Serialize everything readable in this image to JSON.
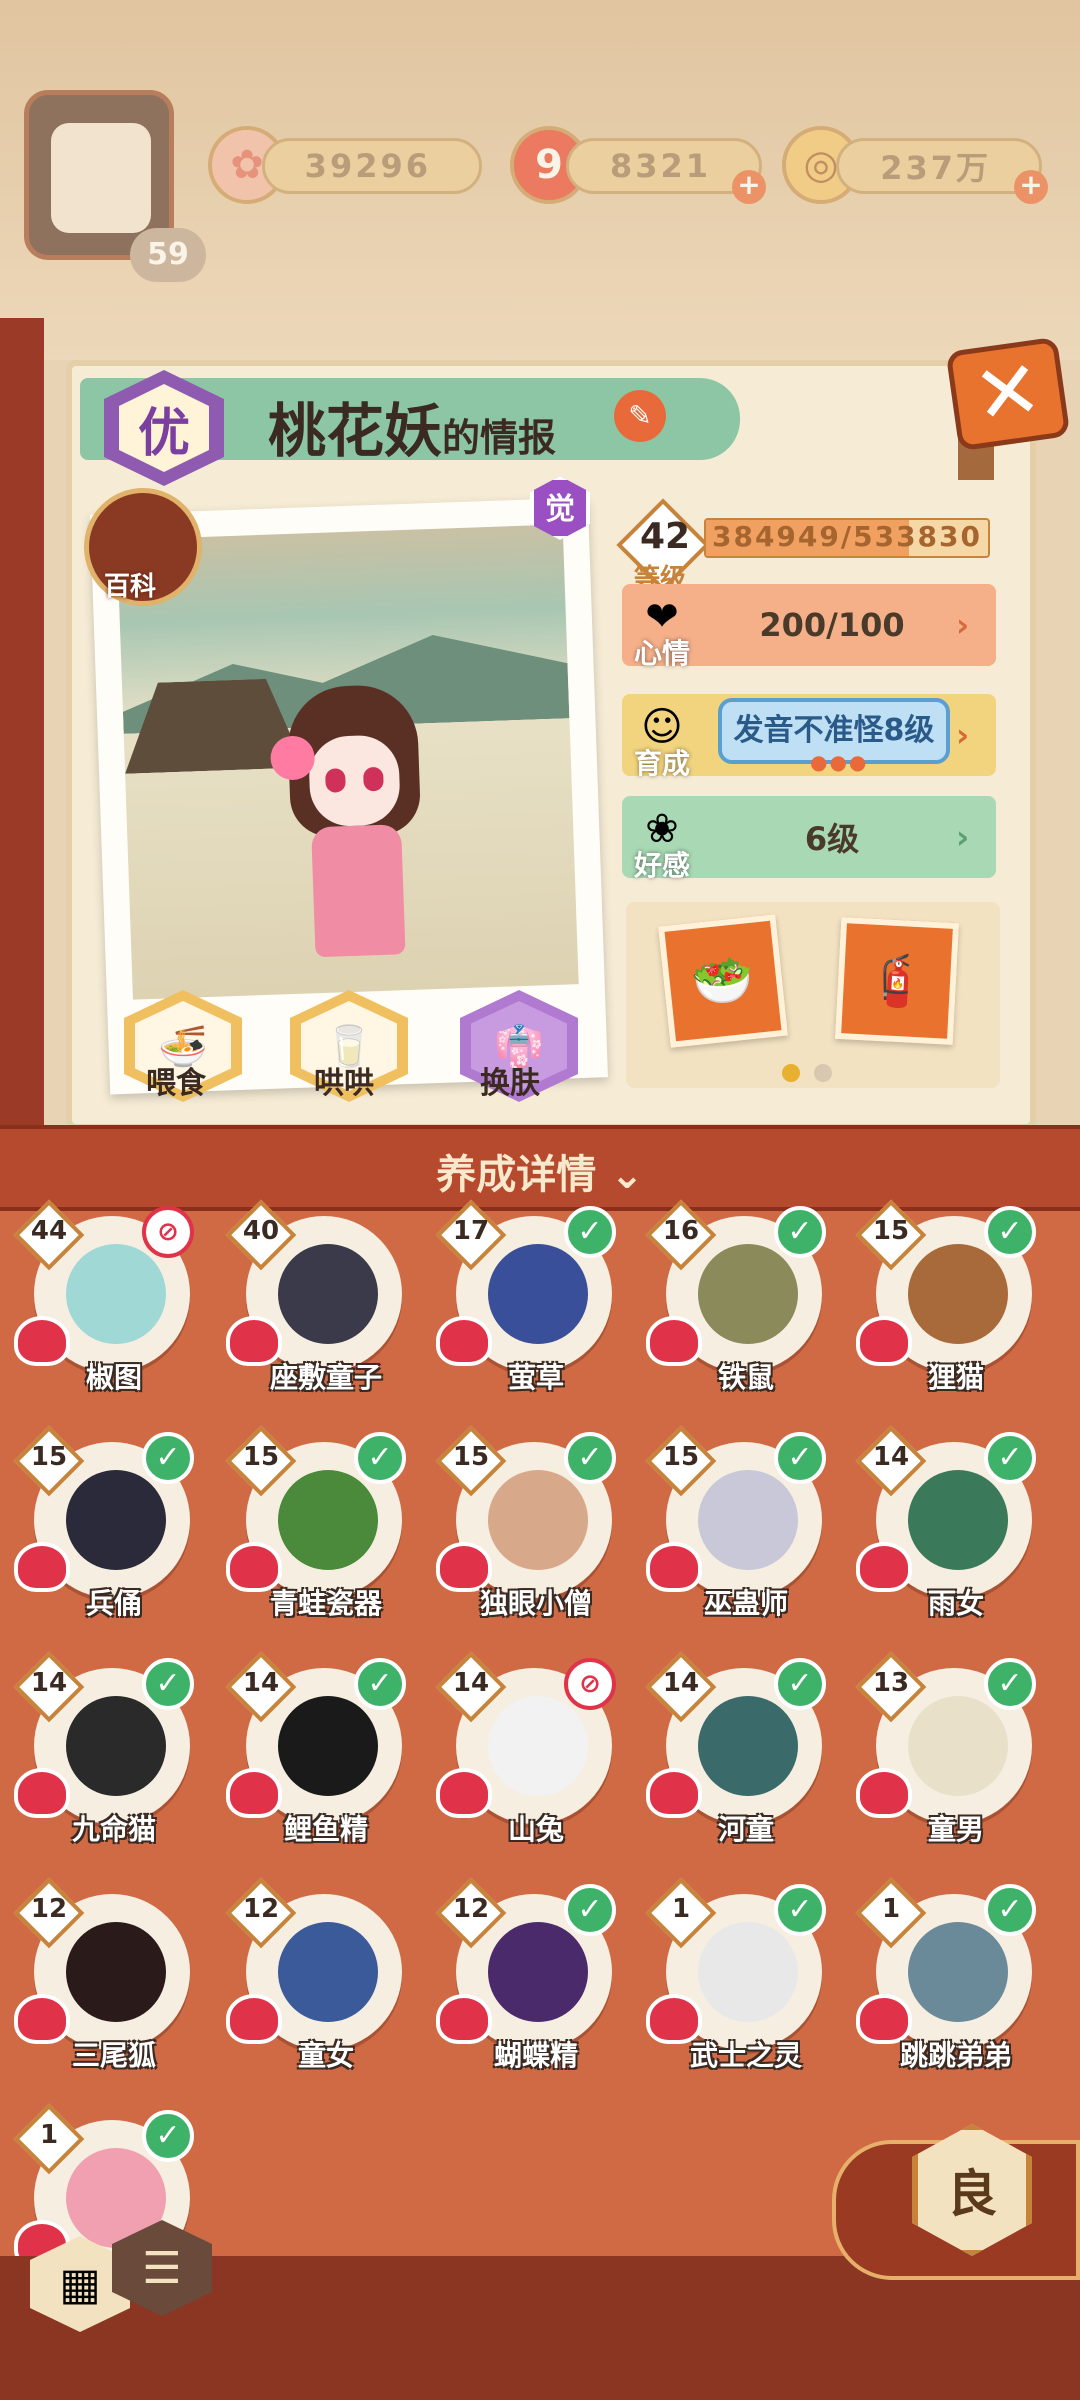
{
  "resources": {
    "sakura_value": "39296",
    "magatama_value": "8321",
    "coins_value": "237万"
  },
  "player": {
    "level": "59"
  },
  "info": {
    "grade": "优",
    "name": "桃花妖",
    "suffix": "的情报",
    "awakened_badge": "觉",
    "encyclopedia_label": "百科",
    "level_label": "等级",
    "level": "42",
    "exp_text": "384949/533830",
    "exp_fraction": 0.72,
    "mood_label": "心情",
    "mood_value": "200/100",
    "nurture_label": "育成",
    "nurture_value": "发音不准怪8级",
    "nurture_dots": "●●●",
    "affection_label": "好感",
    "affection_value": "6级",
    "actions": {
      "feed": "喂食",
      "coax": "哄哄",
      "skin": "换肤"
    }
  },
  "colors": {
    "accent": "#e8732e",
    "mood_bg": "#f5b08a",
    "nurture_bg": "#f2d47e",
    "affection_bg": "#a8d8b4"
  },
  "detail_bar": {
    "label": "养成详情"
  },
  "shikigami": [
    {
      "name": "椒图",
      "level": "44",
      "mark": "ban",
      "color": "#9fd8d4"
    },
    {
      "name": "座敷童子",
      "level": "40",
      "mark": "none",
      "color": "#3a3a4a"
    },
    {
      "name": "萤草",
      "level": "17",
      "mark": "check",
      "color": "#3a4f9a"
    },
    {
      "name": "铁鼠",
      "level": "16",
      "mark": "check",
      "color": "#8a8a5a"
    },
    {
      "name": "狸猫",
      "level": "15",
      "mark": "check",
      "color": "#a86a3a"
    },
    {
      "name": "兵俑",
      "level": "15",
      "mark": "check",
      "color": "#2a2a3a"
    },
    {
      "name": "青蛙瓷器",
      "level": "15",
      "mark": "check",
      "color": "#4a8a3a"
    },
    {
      "name": "独眼小僧",
      "level": "15",
      "mark": "check",
      "color": "#d8a88a"
    },
    {
      "name": "巫蛊师",
      "level": "15",
      "mark": "check",
      "color": "#c8c8d8"
    },
    {
      "name": "雨女",
      "level": "14",
      "mark": "check",
      "color": "#3a7a5a"
    },
    {
      "name": "九命猫",
      "level": "14",
      "mark": "check",
      "color": "#2a2a2a"
    },
    {
      "name": "鲤鱼精",
      "level": "14",
      "mark": "check",
      "color": "#1a1a1a"
    },
    {
      "name": "山兔",
      "level": "14",
      "mark": "ban",
      "color": "#f2f2f2"
    },
    {
      "name": "河童",
      "level": "14",
      "mark": "check",
      "color": "#3a6a6a"
    },
    {
      "name": "童男",
      "level": "13",
      "mark": "check",
      "color": "#e8e0c8"
    },
    {
      "name": "三尾狐",
      "level": "12",
      "mark": "none",
      "color": "#2a1a1a"
    },
    {
      "name": "童女",
      "level": "12",
      "mark": "none",
      "color": "#3a5a9a"
    },
    {
      "name": "蝴蝶精",
      "level": "12",
      "mark": "check",
      "color": "#4a2a6a"
    },
    {
      "name": "武士之灵",
      "level": "1",
      "mark": "check",
      "color": "#e8e8e8"
    },
    {
      "name": "跳跳弟弟",
      "level": "1",
      "mark": "check",
      "color": "#6a8a9a"
    },
    {
      "name": "",
      "level": "1",
      "mark": "check",
      "color": "#f0a0b0"
    }
  ],
  "rarity_tab": "良",
  "icons": {
    "sakura": "sakura-icon",
    "magatama": "magatama-icon",
    "coin": "coin-icon",
    "close": "close-icon",
    "edit": "edit-icon",
    "heart": "heart-icon"
  }
}
